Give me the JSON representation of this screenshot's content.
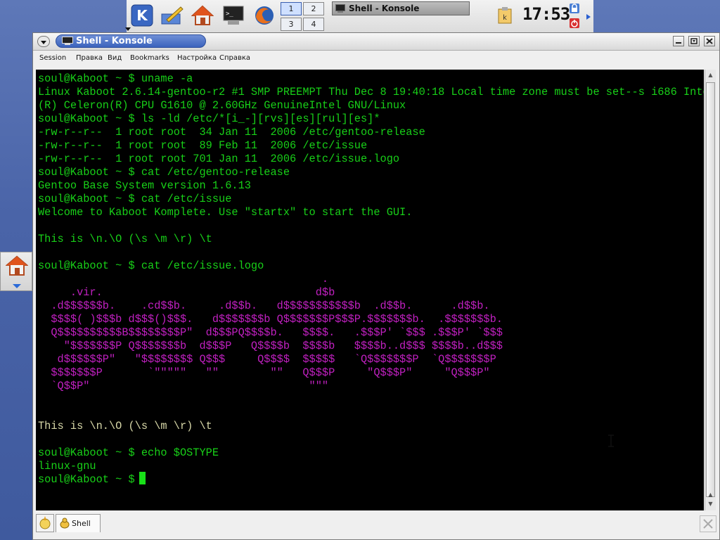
{
  "panel": {
    "pager": [
      "1",
      "2",
      "3",
      "4"
    ],
    "active_desktop": "1",
    "taskbar_button": "Shell - Konsole",
    "clock": "17:53"
  },
  "window": {
    "title": "Shell - Konsole",
    "menus": [
      "Session",
      "Правка",
      "Вид",
      "Bookmarks",
      "Настройка",
      "Справка"
    ]
  },
  "terminal": {
    "lines": [
      {
        "t": "soul@Kaboot ~ $ uname -a",
        "c": "g"
      },
      {
        "t": "Linux Kaboot 2.6.14-gentoo-r2 #1 SMP PREEMPT Thu Dec 8 19:40:18 Local time zone must be set--s i686 Intel",
        "c": "g"
      },
      {
        "t": "(R) Celeron(R) CPU G1610 @ 2.60GHz GenuineIntel GNU/Linux",
        "c": "g"
      },
      {
        "t": "soul@Kaboot ~ $ ls -ld /etc/*[i_-][rvs][es][rul][es]*",
        "c": "g"
      },
      {
        "t": "-rw-r--r--  1 root root  34 Jan 11  2006 /etc/gentoo-release",
        "c": "g"
      },
      {
        "t": "-rw-r--r--  1 root root  89 Feb 11  2006 /etc/issue",
        "c": "g"
      },
      {
        "t": "-rw-r--r--  1 root root 701 Jan 11  2006 /etc/issue.logo",
        "c": "g"
      },
      {
        "t": "soul@Kaboot ~ $ cat /etc/gentoo-release",
        "c": "g"
      },
      {
        "t": "Gentoo Base System version 1.6.13",
        "c": "g"
      },
      {
        "t": "soul@Kaboot ~ $ cat /etc/issue",
        "c": "g"
      },
      {
        "t": "Welcome to Kaboot Komplete. Use \"startx\" to start the GUI.",
        "c": "g"
      },
      {
        "t": "",
        "c": "g"
      },
      {
        "t": "This is \\n.\\O (\\s \\m \\r) \\t",
        "c": "g"
      },
      {
        "t": "",
        "c": "g"
      },
      {
        "t": "soul@Kaboot ~ $ cat /etc/issue.logo",
        "c": "g"
      },
      {
        "t": "                                            .",
        "c": "m"
      },
      {
        "t": "     .vir.                                 d$b",
        "c": "m"
      },
      {
        "t": "  .d$$$$$$b.    .cd$$b.     .d$$b.   d$$$$$$$$$$$b  .d$$b.      .d$$b.",
        "c": "m"
      },
      {
        "t": "  $$$$( )$$$b d$$$()$$$.   d$$$$$$$b Q$$$$$$$P$$$P.$$$$$$$b.  .$$$$$$$b.",
        "c": "m"
      },
      {
        "t": "  Q$$$$$$$$$$B$$$$$$$$P\"  d$$$PQ$$$$b.   $$$$.   .$$$P' `$$$ .$$$P' `$$$",
        "c": "m"
      },
      {
        "t": "    \"$$$$$$$P Q$$$$$$$b  d$$$P   Q$$$$b  $$$$b   $$$$b..d$$$ $$$$b..d$$$",
        "c": "m"
      },
      {
        "t": "   d$$$$$$P\"   \"$$$$$$$$ Q$$$     Q$$$$  $$$$$   `Q$$$$$$$P  `Q$$$$$$$P",
        "c": "m"
      },
      {
        "t": "  $$$$$$$P       `\"\"\"\"\"   \"\"        \"\"   Q$$$P     \"Q$$$P\"     \"Q$$$P\"",
        "c": "m"
      },
      {
        "t": "  `Q$$P\"                                  \"\"\"",
        "c": "m"
      },
      {
        "t": "",
        "c": "g"
      },
      {
        "t": "",
        "c": "g"
      },
      {
        "t": "This is \\n.\\O (\\s \\m \\r) \\t",
        "c": "y"
      },
      {
        "t": "",
        "c": "g"
      },
      {
        "t": "soul@Kaboot ~ $ echo $OSTYPE",
        "c": "g"
      },
      {
        "t": "linux-gnu",
        "c": "g"
      },
      {
        "t": "soul@Kaboot ~ $ ",
        "c": "g"
      }
    ]
  },
  "tabs": {
    "active": "Shell"
  },
  "colors": {
    "terminal_bg": "#000000",
    "terminal_fg": "#18d018",
    "logo": "#c020c0",
    "title_accent": "#3b63bd"
  }
}
